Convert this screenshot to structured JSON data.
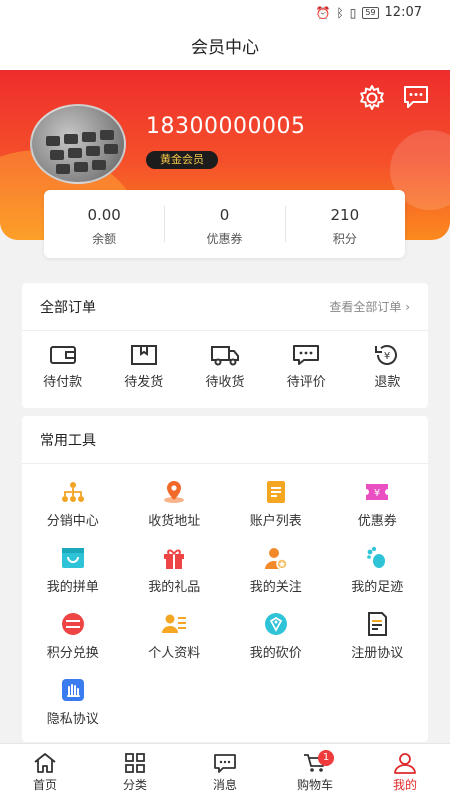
{
  "status_bar": {
    "time": "12:07",
    "battery": "59"
  },
  "header": {
    "title": "会员中心"
  },
  "profile": {
    "phone": "18300000005",
    "level": "黄金会员"
  },
  "stats": [
    {
      "value": "0.00",
      "label": "余额"
    },
    {
      "value": "0",
      "label": "优惠券"
    },
    {
      "value": "210",
      "label": "积分"
    }
  ],
  "orders": {
    "title": "全部订单",
    "more": "查看全部订单 ›",
    "items": [
      {
        "label": "待付款",
        "icon": "wallet-icon"
      },
      {
        "label": "待发货",
        "icon": "package-icon"
      },
      {
        "label": "待收货",
        "icon": "truck-icon"
      },
      {
        "label": "待评价",
        "icon": "comment-icon"
      },
      {
        "label": "退款",
        "icon": "refund-icon"
      }
    ]
  },
  "tools": {
    "title": "常用工具",
    "items": [
      {
        "label": "分销中心",
        "icon": "distribution-icon",
        "color": "#f4a423"
      },
      {
        "label": "收货地址",
        "icon": "location-icon",
        "color": "#f26a2a"
      },
      {
        "label": "账户列表",
        "icon": "list-icon",
        "color": "#f5a623"
      },
      {
        "label": "优惠券",
        "icon": "coupon-icon",
        "color": "#e94fc0"
      },
      {
        "label": "我的拼单",
        "icon": "group-buy-icon",
        "color": "#2ec3d6"
      },
      {
        "label": "我的礼品",
        "icon": "gift-icon",
        "color": "#ee4444"
      },
      {
        "label": "我的关注",
        "icon": "follow-icon",
        "color": "#f28a2a"
      },
      {
        "label": "我的足迹",
        "icon": "footprint-icon",
        "color": "#2ec3d6"
      },
      {
        "label": "积分兑换",
        "icon": "points-icon",
        "color": "#ee4444"
      },
      {
        "label": "个人资料",
        "icon": "profile-icon",
        "color": "#f5a623"
      },
      {
        "label": "我的砍价",
        "icon": "bargain-icon",
        "color": "#2ec3d6"
      },
      {
        "label": "注册协议",
        "icon": "agreement-icon",
        "color": "#333333"
      },
      {
        "label": "隐私协议",
        "icon": "privacy-icon",
        "color": "#3a7cf0"
      }
    ]
  },
  "tabbar": {
    "items": [
      {
        "label": "首页",
        "icon": "home-icon"
      },
      {
        "label": "分类",
        "icon": "category-icon"
      },
      {
        "label": "消息",
        "icon": "message-icon"
      },
      {
        "label": "购物车",
        "icon": "cart-icon",
        "badge": "1"
      },
      {
        "label": "我的",
        "icon": "user-icon",
        "active": true
      }
    ]
  },
  "colors": {
    "accent": "#e02a2a",
    "hero_top": "#ee2d2d",
    "hero_bottom": "#fb8a1e",
    "level_text": "#f2c54a"
  }
}
